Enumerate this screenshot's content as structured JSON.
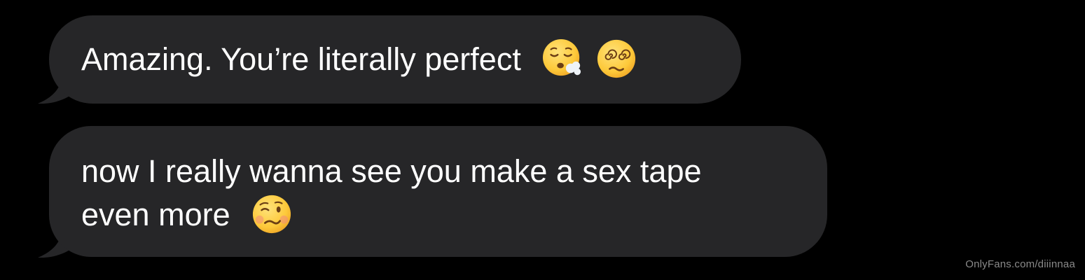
{
  "messages": [
    {
      "lines": [
        "Amazing. You’re literally perfect"
      ],
      "emojis": [
        "face-exhaling-emoji",
        "face-with-spiral-eyes-emoji"
      ]
    },
    {
      "lines": [
        "now I really wanna see you make a sex tape",
        "even more"
      ],
      "emojis": [
        "woozy-face-emoji"
      ]
    }
  ],
  "watermark": "OnlyFans.com/diiinnaa",
  "colors": {
    "background": "#000000",
    "bubble": "#262628",
    "text": "#ffffff",
    "watermark": "#8a8a8a",
    "emoji_yellow": "#fdc93a"
  }
}
